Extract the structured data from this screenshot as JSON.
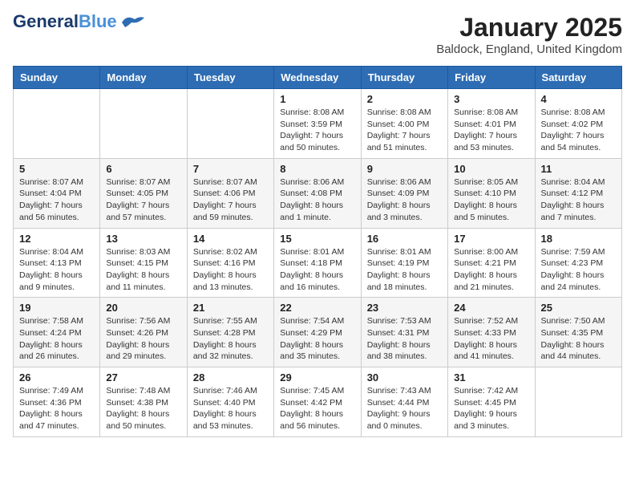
{
  "header": {
    "logo_general": "General",
    "logo_blue": "Blue",
    "month": "January 2025",
    "location": "Baldock, England, United Kingdom"
  },
  "days_of_week": [
    "Sunday",
    "Monday",
    "Tuesday",
    "Wednesday",
    "Thursday",
    "Friday",
    "Saturday"
  ],
  "weeks": [
    [
      {
        "day": "",
        "info": ""
      },
      {
        "day": "",
        "info": ""
      },
      {
        "day": "",
        "info": ""
      },
      {
        "day": "1",
        "info": "Sunrise: 8:08 AM\nSunset: 3:59 PM\nDaylight: 7 hours\nand 50 minutes."
      },
      {
        "day": "2",
        "info": "Sunrise: 8:08 AM\nSunset: 4:00 PM\nDaylight: 7 hours\nand 51 minutes."
      },
      {
        "day": "3",
        "info": "Sunrise: 8:08 AM\nSunset: 4:01 PM\nDaylight: 7 hours\nand 53 minutes."
      },
      {
        "day": "4",
        "info": "Sunrise: 8:08 AM\nSunset: 4:02 PM\nDaylight: 7 hours\nand 54 minutes."
      }
    ],
    [
      {
        "day": "5",
        "info": "Sunrise: 8:07 AM\nSunset: 4:04 PM\nDaylight: 7 hours\nand 56 minutes."
      },
      {
        "day": "6",
        "info": "Sunrise: 8:07 AM\nSunset: 4:05 PM\nDaylight: 7 hours\nand 57 minutes."
      },
      {
        "day": "7",
        "info": "Sunrise: 8:07 AM\nSunset: 4:06 PM\nDaylight: 7 hours\nand 59 minutes."
      },
      {
        "day": "8",
        "info": "Sunrise: 8:06 AM\nSunset: 4:08 PM\nDaylight: 8 hours\nand 1 minute."
      },
      {
        "day": "9",
        "info": "Sunrise: 8:06 AM\nSunset: 4:09 PM\nDaylight: 8 hours\nand 3 minutes."
      },
      {
        "day": "10",
        "info": "Sunrise: 8:05 AM\nSunset: 4:10 PM\nDaylight: 8 hours\nand 5 minutes."
      },
      {
        "day": "11",
        "info": "Sunrise: 8:04 AM\nSunset: 4:12 PM\nDaylight: 8 hours\nand 7 minutes."
      }
    ],
    [
      {
        "day": "12",
        "info": "Sunrise: 8:04 AM\nSunset: 4:13 PM\nDaylight: 8 hours\nand 9 minutes."
      },
      {
        "day": "13",
        "info": "Sunrise: 8:03 AM\nSunset: 4:15 PM\nDaylight: 8 hours\nand 11 minutes."
      },
      {
        "day": "14",
        "info": "Sunrise: 8:02 AM\nSunset: 4:16 PM\nDaylight: 8 hours\nand 13 minutes."
      },
      {
        "day": "15",
        "info": "Sunrise: 8:01 AM\nSunset: 4:18 PM\nDaylight: 8 hours\nand 16 minutes."
      },
      {
        "day": "16",
        "info": "Sunrise: 8:01 AM\nSunset: 4:19 PM\nDaylight: 8 hours\nand 18 minutes."
      },
      {
        "day": "17",
        "info": "Sunrise: 8:00 AM\nSunset: 4:21 PM\nDaylight: 8 hours\nand 21 minutes."
      },
      {
        "day": "18",
        "info": "Sunrise: 7:59 AM\nSunset: 4:23 PM\nDaylight: 8 hours\nand 24 minutes."
      }
    ],
    [
      {
        "day": "19",
        "info": "Sunrise: 7:58 AM\nSunset: 4:24 PM\nDaylight: 8 hours\nand 26 minutes."
      },
      {
        "day": "20",
        "info": "Sunrise: 7:56 AM\nSunset: 4:26 PM\nDaylight: 8 hours\nand 29 minutes."
      },
      {
        "day": "21",
        "info": "Sunrise: 7:55 AM\nSunset: 4:28 PM\nDaylight: 8 hours\nand 32 minutes."
      },
      {
        "day": "22",
        "info": "Sunrise: 7:54 AM\nSunset: 4:29 PM\nDaylight: 8 hours\nand 35 minutes."
      },
      {
        "day": "23",
        "info": "Sunrise: 7:53 AM\nSunset: 4:31 PM\nDaylight: 8 hours\nand 38 minutes."
      },
      {
        "day": "24",
        "info": "Sunrise: 7:52 AM\nSunset: 4:33 PM\nDaylight: 8 hours\nand 41 minutes."
      },
      {
        "day": "25",
        "info": "Sunrise: 7:50 AM\nSunset: 4:35 PM\nDaylight: 8 hours\nand 44 minutes."
      }
    ],
    [
      {
        "day": "26",
        "info": "Sunrise: 7:49 AM\nSunset: 4:36 PM\nDaylight: 8 hours\nand 47 minutes."
      },
      {
        "day": "27",
        "info": "Sunrise: 7:48 AM\nSunset: 4:38 PM\nDaylight: 8 hours\nand 50 minutes."
      },
      {
        "day": "28",
        "info": "Sunrise: 7:46 AM\nSunset: 4:40 PM\nDaylight: 8 hours\nand 53 minutes."
      },
      {
        "day": "29",
        "info": "Sunrise: 7:45 AM\nSunset: 4:42 PM\nDaylight: 8 hours\nand 56 minutes."
      },
      {
        "day": "30",
        "info": "Sunrise: 7:43 AM\nSunset: 4:44 PM\nDaylight: 9 hours\nand 0 minutes."
      },
      {
        "day": "31",
        "info": "Sunrise: 7:42 AM\nSunset: 4:45 PM\nDaylight: 9 hours\nand 3 minutes."
      },
      {
        "day": "",
        "info": ""
      }
    ]
  ]
}
